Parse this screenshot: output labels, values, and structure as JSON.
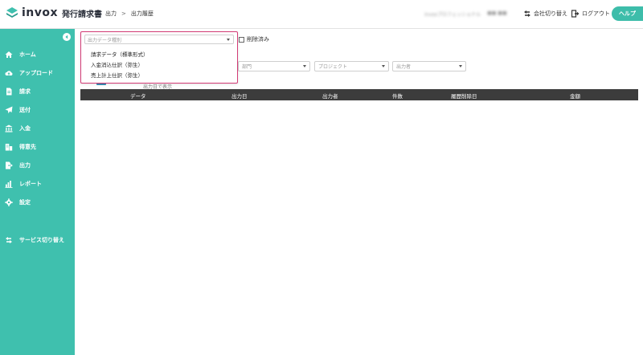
{
  "header": {
    "logo_text": "invox",
    "logo_sub": "発行請求書",
    "breadcrumb": [
      "出力",
      "出力履歴"
    ],
    "breadcrumb_sep": ">",
    "account_org": "invoxプロフェッショナル",
    "account_user": "■■ ■■",
    "switch_company": "会社切り替え",
    "logout": "ログアウト",
    "help": "ヘルプ"
  },
  "sidebar": {
    "items": [
      {
        "label": "ホーム",
        "icon": "home-icon"
      },
      {
        "label": "アップロード",
        "icon": "cloud-upload-icon"
      },
      {
        "label": "請求",
        "icon": "document-icon"
      },
      {
        "label": "送付",
        "icon": "paper-plane-icon"
      },
      {
        "label": "入金",
        "icon": "bank-icon"
      },
      {
        "label": "得意先",
        "icon": "building-icon"
      },
      {
        "label": "出力",
        "icon": "export-icon"
      },
      {
        "label": "レポート",
        "icon": "bar-chart-icon"
      },
      {
        "label": "設定",
        "icon": "gear-icon"
      },
      {
        "label": "サービス切り替え",
        "icon": "switch-icon"
      }
    ]
  },
  "filters": {
    "output_type_placeholder": "出力データ種別",
    "deleted_label": "削除済み",
    "department_placeholder": "部門",
    "project_placeholder": "プロジェクト",
    "outputter_placeholder": "出力者"
  },
  "dropdown": {
    "options": [
      "請求データ（標準形式）",
      "入金消込仕訳（弥生）",
      "売上計上仕訳（弥生）"
    ]
  },
  "partial_text": "出力日で表示",
  "table": {
    "columns": [
      "データ",
      "出力日",
      "出力者",
      "件数",
      "履歴削除日",
      "金額"
    ]
  },
  "colors": {
    "accent": "#3fc0ae",
    "highlight_border": "#d33c76",
    "table_header": "#3c3c3c"
  }
}
